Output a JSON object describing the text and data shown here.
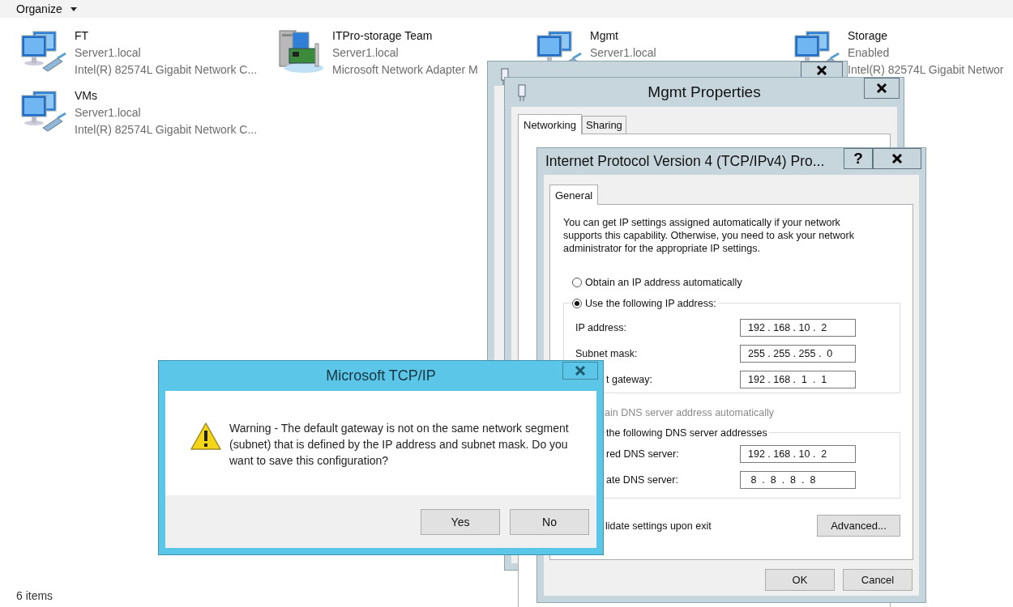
{
  "explorer": {
    "toolbar": {
      "organize": "Organize"
    },
    "items": [
      {
        "kind": "adapter",
        "name": "FT",
        "line2": "Server1.local",
        "line3": "Intel(R) 82574L Gigabit Network C..."
      },
      {
        "kind": "team",
        "name": "ITPro-storage Team",
        "line2": "Server1.local",
        "line3": "Microsoft Network Adapter M"
      },
      {
        "kind": "adapter",
        "name": "Mgmt",
        "line2": "Server1.local"
      },
      {
        "kind": "adapter",
        "name": "Storage",
        "line2": "Enabled",
        "line3": "Intel(R) 82574L Gigabit Networ"
      },
      {
        "kind": "adapter",
        "name": "VMs",
        "line2": "Server1.local",
        "line3": "Intel(R) 82574L Gigabit Network C..."
      }
    ],
    "status": "6 items"
  },
  "status_window": {
    "kind": "window"
  },
  "properties_window": {
    "title": "Mgmt Properties",
    "tabs": [
      {
        "label": "Networking",
        "selected": true
      },
      {
        "label": "Sharing",
        "selected": false
      }
    ]
  },
  "ipv4_window": {
    "title": "Internet Protocol Version 4 (TCP/IPv4) Pro...",
    "help": "?",
    "tabs": [
      {
        "label": "General",
        "selected": true
      }
    ],
    "description": "You can get IP settings assigned automatically if your network supports this capability. Otherwise, you need to ask your network administrator for the appropriate IP settings.",
    "ip_options": [
      {
        "label": "Obtain an IP address automatically",
        "selected": false
      },
      {
        "label": "Use the following IP address:",
        "selected": true
      }
    ],
    "ip_fields": [
      {
        "label": "IP address:",
        "value": "192 . 168 . 10 .  2"
      },
      {
        "label": "Subnet mask:",
        "value": "255 . 255 . 255 .  0"
      },
      {
        "label": "t gateway:",
        "value": "192 . 168 .  1  .  1"
      }
    ],
    "dns_auto_label": "ain DNS server address automatically",
    "dns_manual_label": "the following DNS server addresses",
    "dns_fields": [
      {
        "label": "red DNS server:",
        "value": "192 . 168 . 10 .  2"
      },
      {
        "label": "ate DNS server:",
        "value": " 8  .  8  .  8  .  8"
      }
    ],
    "validate_label": "lidate settings upon exit",
    "advanced": "Advanced...",
    "ok": "OK",
    "cancel": "Cancel"
  },
  "alert": {
    "title": "Microsoft TCP/IP",
    "message": "Warning - The default gateway is not on the same network segment (subnet) that is defined by the IP address and subnet mask. Do you want to save this configuration?",
    "buttons": [
      "Yes",
      "No"
    ]
  }
}
